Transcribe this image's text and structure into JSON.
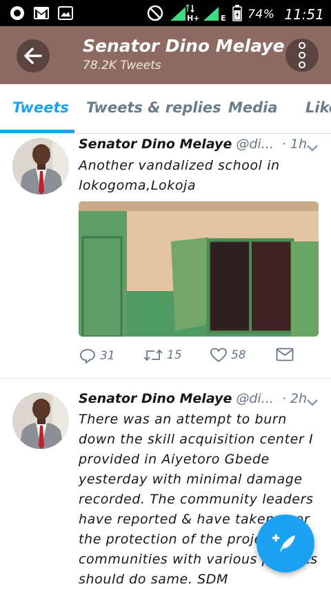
{
  "status_bar": {
    "battery": "74%",
    "time": "11:51",
    "network_h": "H+",
    "network_e": "E"
  },
  "header": {
    "title": "Senator Dino Melaye",
    "subtitle": "78.2K Tweets"
  },
  "tabs": [
    {
      "label": "Tweets",
      "active": true
    },
    {
      "label": "Tweets & replies",
      "active": false
    },
    {
      "label": "Media",
      "active": false
    },
    {
      "label": "Likes",
      "active": false
    }
  ],
  "tweets": [
    {
      "name": "Senator Dino Melaye",
      "handle": "@di...",
      "time": "· 1h",
      "text_lines": [
        "Another vandalized school in",
        "lokogoma,Lokoja"
      ],
      "replies": "31",
      "retweets": "15",
      "likes": "58"
    },
    {
      "name": "Senator Dino Melaye",
      "handle": "@di...",
      "time": "· 2h",
      "text_lines": [
        "There was an attempt to burn",
        "down the skill acquisition center I",
        "provided in Aiyetoro Gbede",
        "yesterday with minimal damage",
        "recorded. The community leaders",
        "have reported & have taken over",
        "the protection of the project. All",
        "communities with various projects",
        "should do same. SDM"
      ]
    }
  ],
  "colors": {
    "header_bg": "#8d6a62",
    "accent": "#1da1f2"
  }
}
